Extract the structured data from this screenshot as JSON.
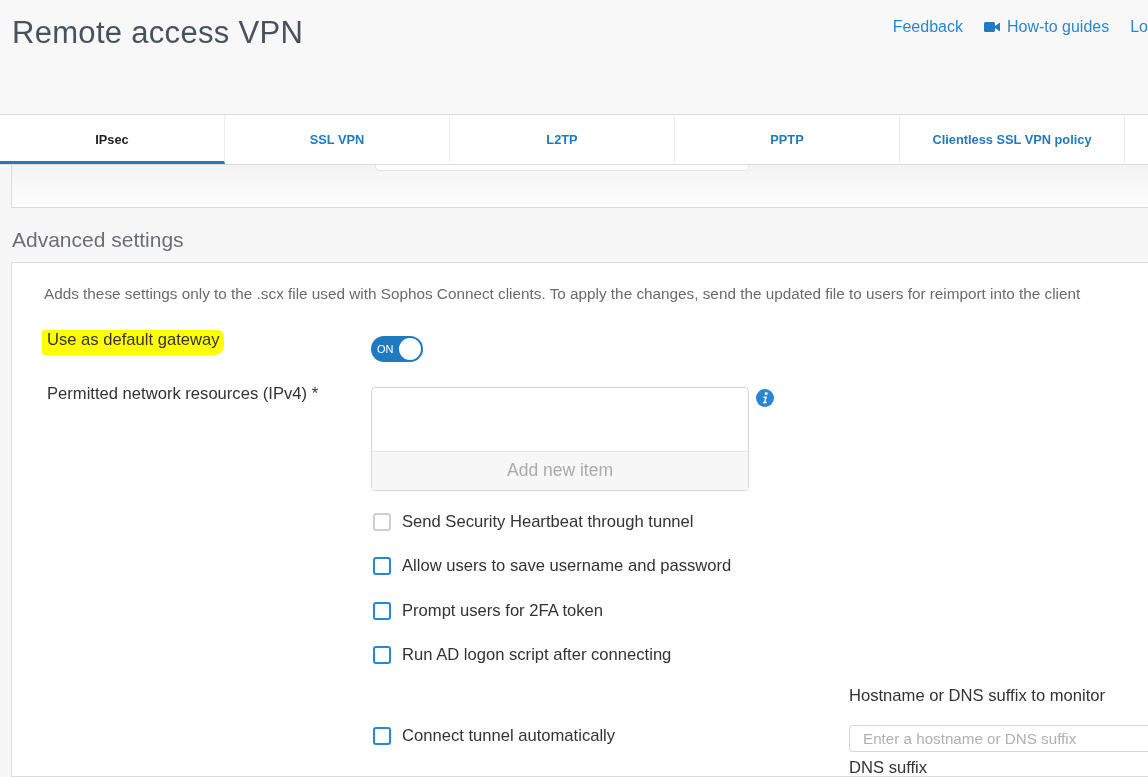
{
  "header": {
    "title": "Remote access VPN",
    "links": [
      {
        "kind": "text",
        "label": "Feedback"
      },
      {
        "kind": "video",
        "label": "How-to guides"
      },
      {
        "kind": "text",
        "label": "Lo"
      }
    ]
  },
  "tabs": [
    {
      "label": "IPsec",
      "selected": true
    },
    {
      "label": "SSL VPN",
      "selected": false
    },
    {
      "label": "L2TP",
      "selected": false
    },
    {
      "label": "PPTP",
      "selected": false
    },
    {
      "label": "Clientless SSL VPN policy",
      "selected": false
    }
  ],
  "advanced_settings": {
    "heading": "Advanced settings",
    "description": "Adds these settings only to the .scx file used with Sophos Connect clients. To apply the changes, send the updated file to users for reimport into the client",
    "default_gateway": {
      "label": "Use as default gateway",
      "highlighted": true,
      "on": true,
      "toggle_text": "ON"
    },
    "permitted_resources": {
      "label": "Permitted network resources (IPv4) *",
      "add_button": "Add new item"
    },
    "options": [
      {
        "label": "Send Security Heartbeat through tunnel",
        "checked": false,
        "disabled": true
      },
      {
        "label": "Allow users to save username and password",
        "checked": false,
        "disabled": false
      },
      {
        "label": "Prompt users for 2FA token",
        "checked": false,
        "disabled": false
      },
      {
        "label": "Run AD logon script after connecting",
        "checked": false,
        "disabled": false
      }
    ],
    "auto_connect": {
      "label": "Connect tunnel automatically",
      "checked": false,
      "monitor_label": "Hostname or DNS suffix to monitor",
      "monitor_placeholder": "Enter a hostname or DNS suffix",
      "dns_suffix_label": "DNS suffix"
    }
  }
}
